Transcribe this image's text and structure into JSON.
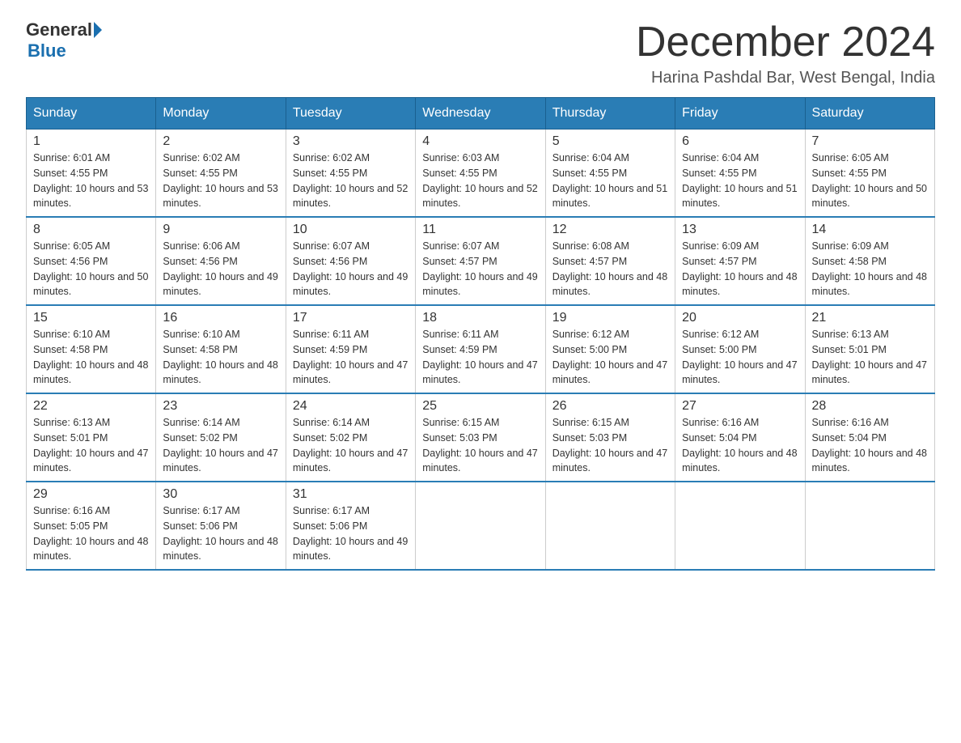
{
  "header": {
    "logo_general": "General",
    "logo_blue": "Blue",
    "title": "December 2024",
    "subtitle": "Harina Pashdal Bar, West Bengal, India"
  },
  "weekdays": [
    "Sunday",
    "Monday",
    "Tuesday",
    "Wednesday",
    "Thursday",
    "Friday",
    "Saturday"
  ],
  "weeks": [
    [
      {
        "day": "1",
        "sunrise": "6:01 AM",
        "sunset": "4:55 PM",
        "daylight": "10 hours and 53 minutes."
      },
      {
        "day": "2",
        "sunrise": "6:02 AM",
        "sunset": "4:55 PM",
        "daylight": "10 hours and 53 minutes."
      },
      {
        "day": "3",
        "sunrise": "6:02 AM",
        "sunset": "4:55 PM",
        "daylight": "10 hours and 52 minutes."
      },
      {
        "day": "4",
        "sunrise": "6:03 AM",
        "sunset": "4:55 PM",
        "daylight": "10 hours and 52 minutes."
      },
      {
        "day": "5",
        "sunrise": "6:04 AM",
        "sunset": "4:55 PM",
        "daylight": "10 hours and 51 minutes."
      },
      {
        "day": "6",
        "sunrise": "6:04 AM",
        "sunset": "4:55 PM",
        "daylight": "10 hours and 51 minutes."
      },
      {
        "day": "7",
        "sunrise": "6:05 AM",
        "sunset": "4:55 PM",
        "daylight": "10 hours and 50 minutes."
      }
    ],
    [
      {
        "day": "8",
        "sunrise": "6:05 AM",
        "sunset": "4:56 PM",
        "daylight": "10 hours and 50 minutes."
      },
      {
        "day": "9",
        "sunrise": "6:06 AM",
        "sunset": "4:56 PM",
        "daylight": "10 hours and 49 minutes."
      },
      {
        "day": "10",
        "sunrise": "6:07 AM",
        "sunset": "4:56 PM",
        "daylight": "10 hours and 49 minutes."
      },
      {
        "day": "11",
        "sunrise": "6:07 AM",
        "sunset": "4:57 PM",
        "daylight": "10 hours and 49 minutes."
      },
      {
        "day": "12",
        "sunrise": "6:08 AM",
        "sunset": "4:57 PM",
        "daylight": "10 hours and 48 minutes."
      },
      {
        "day": "13",
        "sunrise": "6:09 AM",
        "sunset": "4:57 PM",
        "daylight": "10 hours and 48 minutes."
      },
      {
        "day": "14",
        "sunrise": "6:09 AM",
        "sunset": "4:58 PM",
        "daylight": "10 hours and 48 minutes."
      }
    ],
    [
      {
        "day": "15",
        "sunrise": "6:10 AM",
        "sunset": "4:58 PM",
        "daylight": "10 hours and 48 minutes."
      },
      {
        "day": "16",
        "sunrise": "6:10 AM",
        "sunset": "4:58 PM",
        "daylight": "10 hours and 48 minutes."
      },
      {
        "day": "17",
        "sunrise": "6:11 AM",
        "sunset": "4:59 PM",
        "daylight": "10 hours and 47 minutes."
      },
      {
        "day": "18",
        "sunrise": "6:11 AM",
        "sunset": "4:59 PM",
        "daylight": "10 hours and 47 minutes."
      },
      {
        "day": "19",
        "sunrise": "6:12 AM",
        "sunset": "5:00 PM",
        "daylight": "10 hours and 47 minutes."
      },
      {
        "day": "20",
        "sunrise": "6:12 AM",
        "sunset": "5:00 PM",
        "daylight": "10 hours and 47 minutes."
      },
      {
        "day": "21",
        "sunrise": "6:13 AM",
        "sunset": "5:01 PM",
        "daylight": "10 hours and 47 minutes."
      }
    ],
    [
      {
        "day": "22",
        "sunrise": "6:13 AM",
        "sunset": "5:01 PM",
        "daylight": "10 hours and 47 minutes."
      },
      {
        "day": "23",
        "sunrise": "6:14 AM",
        "sunset": "5:02 PM",
        "daylight": "10 hours and 47 minutes."
      },
      {
        "day": "24",
        "sunrise": "6:14 AM",
        "sunset": "5:02 PM",
        "daylight": "10 hours and 47 minutes."
      },
      {
        "day": "25",
        "sunrise": "6:15 AM",
        "sunset": "5:03 PM",
        "daylight": "10 hours and 47 minutes."
      },
      {
        "day": "26",
        "sunrise": "6:15 AM",
        "sunset": "5:03 PM",
        "daylight": "10 hours and 47 minutes."
      },
      {
        "day": "27",
        "sunrise": "6:16 AM",
        "sunset": "5:04 PM",
        "daylight": "10 hours and 48 minutes."
      },
      {
        "day": "28",
        "sunrise": "6:16 AM",
        "sunset": "5:04 PM",
        "daylight": "10 hours and 48 minutes."
      }
    ],
    [
      {
        "day": "29",
        "sunrise": "6:16 AM",
        "sunset": "5:05 PM",
        "daylight": "10 hours and 48 minutes."
      },
      {
        "day": "30",
        "sunrise": "6:17 AM",
        "sunset": "5:06 PM",
        "daylight": "10 hours and 48 minutes."
      },
      {
        "day": "31",
        "sunrise": "6:17 AM",
        "sunset": "5:06 PM",
        "daylight": "10 hours and 49 minutes."
      },
      null,
      null,
      null,
      null
    ]
  ],
  "labels": {
    "sunrise": "Sunrise:",
    "sunset": "Sunset:",
    "daylight": "Daylight:"
  }
}
